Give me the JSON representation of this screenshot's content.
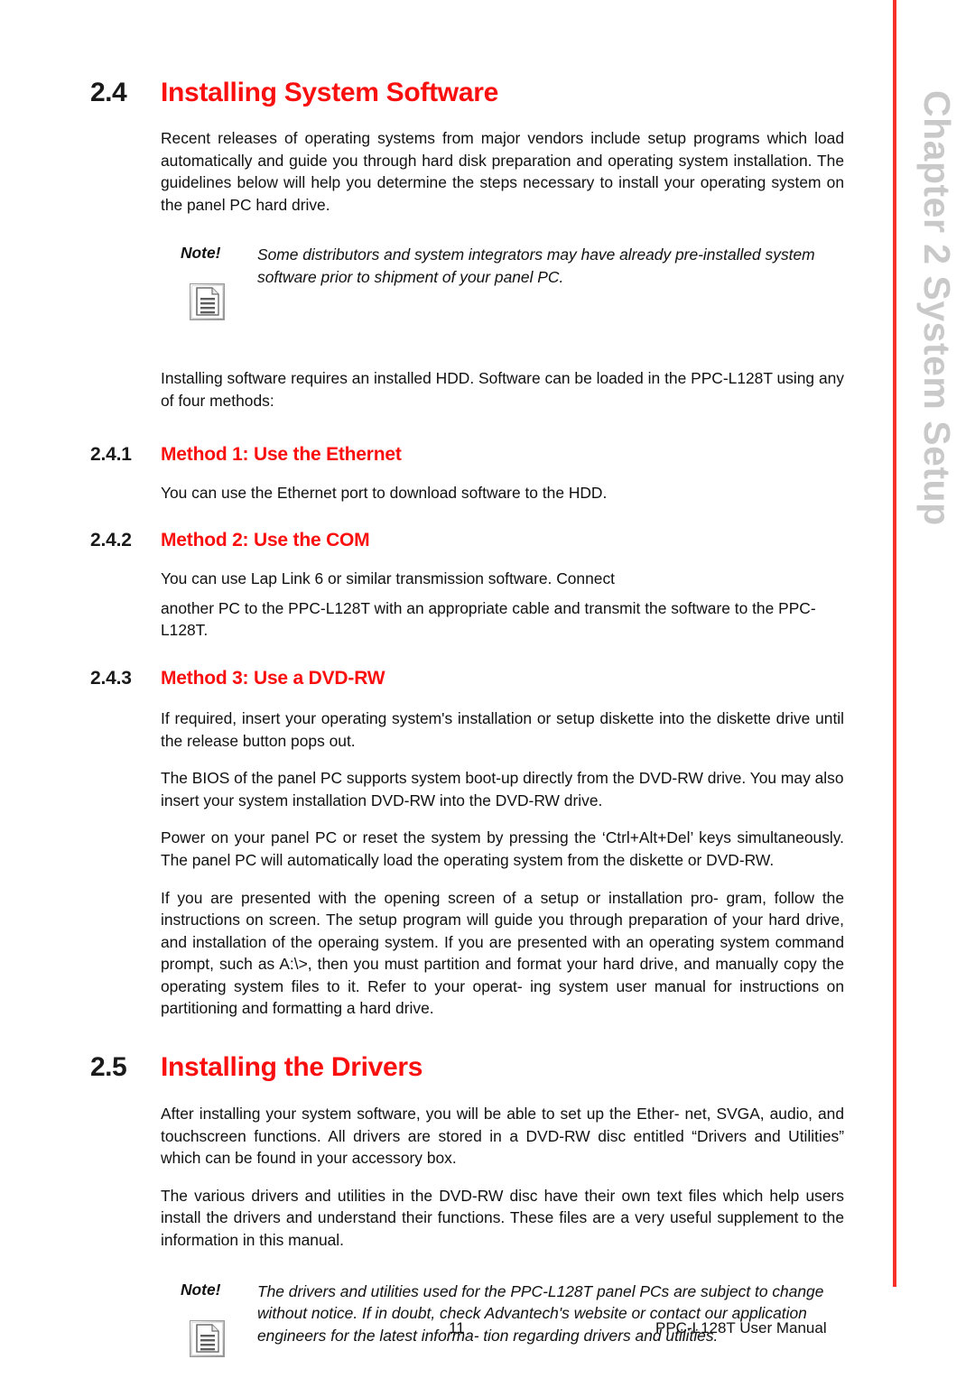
{
  "sidebar": {
    "label": "Chapter 2  System Setup",
    "rule_color": "#f8302a",
    "text_color": "#c9c9c9"
  },
  "theme": {
    "heading_red": "#fa0f0f",
    "body_black": "#111111",
    "page_background": "#ffffff"
  },
  "sections": {
    "s24": {
      "number": "2.4",
      "title": "Installing System Software",
      "intro": "Recent releases of operating systems from major vendors include setup programs which load automatically and guide you through hard disk preparation and operating system installation. The guidelines below will help you determine the steps necessary to install your operating system on the panel PC hard drive.",
      "note": {
        "label": "Note!",
        "icon": "note-document-icon",
        "text": "Some distributors and system integrators may have already pre-installed system software prior to shipment of your panel PC."
      },
      "after_note": "Installing software requires an installed HDD. Software can be loaded in the PPC-L128T using any of four methods:"
    },
    "s241": {
      "number": "2.4.1",
      "title": "Method 1: Use the Ethernet",
      "body": "You can use the Ethernet port to download software to the HDD."
    },
    "s242": {
      "number": "2.4.2",
      "title": "Method 2: Use the COM",
      "body_line1": "You can use Lap Link 6 or similar transmission software. Connect",
      "body_line2": "another PC to the PPC-L128T with an appropriate cable and transmit the software to the PPC-L128T."
    },
    "s243": {
      "number": "2.4.3",
      "title": "Method 3: Use a DVD-RW",
      "p1": "If required, insert your operating system's installation or setup diskette into the diskette drive until the release button pops out.",
      "p2": "The BIOS of the panel PC supports system boot-up directly from the DVD-RW drive. You may also insert your system installation DVD-RW into the DVD-RW drive.",
      "p3": "Power on your panel PC or reset the system by pressing the ‘Ctrl+Alt+Del’ keys simultaneously. The panel PC will automatically load the operating system from the diskette or DVD-RW.",
      "p4": "If you are presented with the opening screen of a setup or installation pro- gram, follow the instructions on screen. The setup program will guide you through preparation of your hard drive, and installation of the operaing system. If you are presented with an operating system command prompt, such as A:\\>, then you must partition and format your hard drive, and manually copy the operating system files to it. Refer to your operat- ing system user manual for instructions on partitioning and formatting a hard drive."
    },
    "s25": {
      "number": "2.5",
      "title": "Installing the Drivers",
      "p1": "After installing your system software, you will be able to set up the Ether- net, SVGA, audio, and touchscreen functions. All drivers are stored in a DVD-RW disc entitled “Drivers and Utilities” which can be found in your accessory box.",
      "p2": "The various drivers and utilities in the DVD-RW disc have their own text files which help users install the drivers and understand their functions. These files are a very useful supplement to the information in this manual.",
      "note": {
        "label": "Note!",
        "icon": "note-document-icon",
        "text": "The drivers and utilities used for the PPC-L128T panel PCs are subject to change without notice. If in doubt, check Advantech's website or contact our application engineers for the latest informa- tion regarding drivers and utilities."
      }
    }
  },
  "footer": {
    "page_number": "11",
    "manual_title": "PPC-L128T User Manual"
  }
}
